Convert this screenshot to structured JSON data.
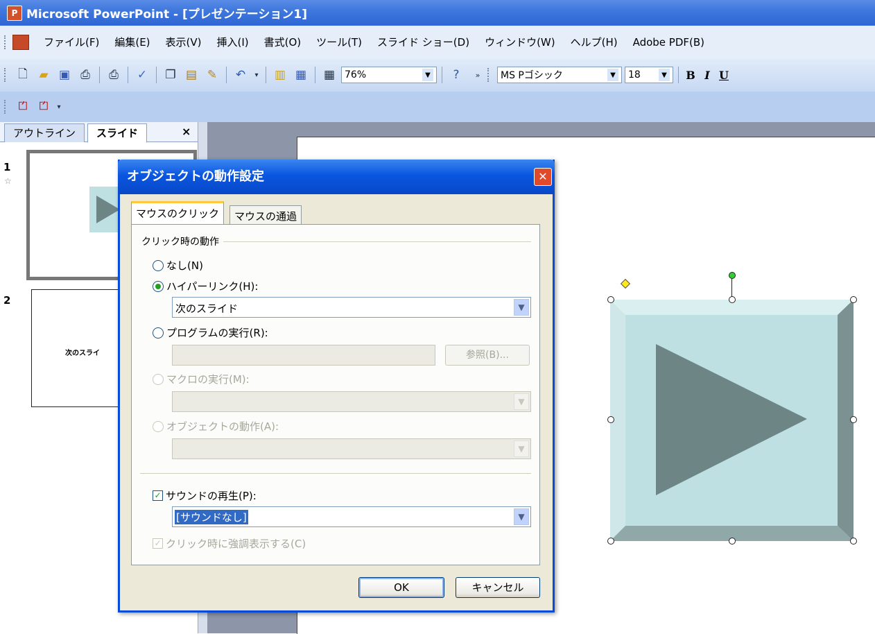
{
  "window": {
    "title": "Microsoft PowerPoint - [プレゼンテーション1]"
  },
  "menu": [
    "ファイル(F)",
    "編集(E)",
    "表示(V)",
    "挿入(I)",
    "書式(O)",
    "ツール(T)",
    "スライド ショー(D)",
    "ウィンドウ(W)",
    "ヘルプ(H)",
    "Adobe PDF(B)"
  ],
  "toolbar": {
    "zoom": "76%",
    "font_name": "MS Pゴシック",
    "font_size": "18",
    "bold": "B",
    "italic": "I",
    "underline": "U"
  },
  "panel_tabs": {
    "outline": "アウトライン",
    "slides": "スライド",
    "close": "×"
  },
  "thumbnails": [
    {
      "number": "1"
    },
    {
      "number": "2",
      "text": "次のスライ"
    }
  ],
  "dialog": {
    "title": "オブジェクトの動作設定",
    "close": "✕",
    "tabs": {
      "click": "マウスのクリック",
      "over": "マウスの通過"
    },
    "group_label": "クリック時の動作",
    "options": {
      "none": "なし(N)",
      "hyperlink": "ハイパーリンク(H):",
      "program": "プログラムの実行(R):",
      "macro": "マクロの実行(M):",
      "object_action": "オブジェクトの動作(A):"
    },
    "selected_option": "hyperlink",
    "hyperlink_value": "次のスライド",
    "browse": "参照(B)...",
    "play_sound": "サウンドの再生(P):",
    "play_sound_checked": true,
    "sound_value": "[サウンドなし]",
    "highlight": "クリック時に強調表示する(C)",
    "highlight_checked": true,
    "ok": "OK",
    "cancel": "キャンセル"
  },
  "colors": {
    "titlebar": "#3f78de",
    "dialog_title": "#0a56e0",
    "shape_face": "#bfe0e2",
    "shape_triangle": "#6e8586"
  }
}
